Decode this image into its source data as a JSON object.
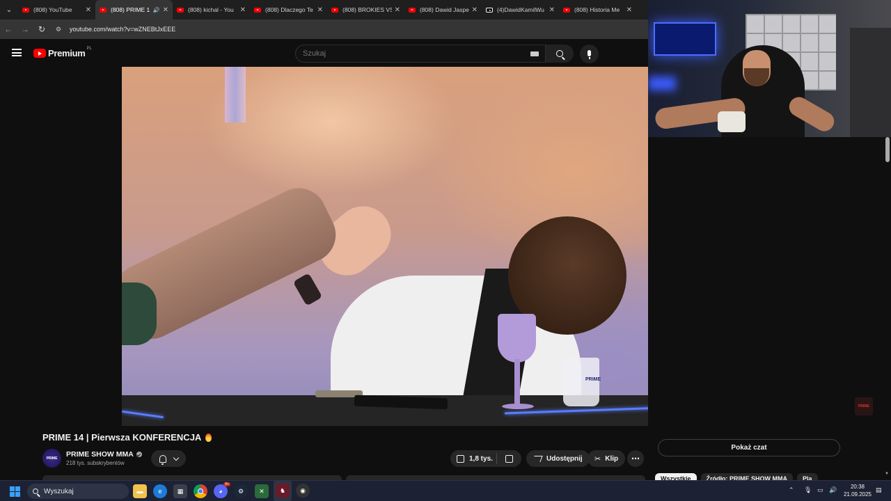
{
  "browser": {
    "tabs": [
      {
        "title": "(808) YouTube",
        "active": false,
        "icon": "youtube-icon"
      },
      {
        "title": "(808) PRIME 1",
        "active": true,
        "icon": "youtube-icon",
        "audio": true
      },
      {
        "title": "(808) kichal - You",
        "active": false,
        "icon": "youtube-icon"
      },
      {
        "title": "(808) Dlaczego Te",
        "active": false,
        "icon": "youtube-icon"
      },
      {
        "title": "(808) BROKIES VS",
        "active": false,
        "icon": "youtube-icon"
      },
      {
        "title": "(808) Dawid Jaspe",
        "active": false,
        "icon": "youtube-icon"
      },
      {
        "title": "(4)DawidKamilWu",
        "active": false,
        "icon": "tiktok-icon"
      },
      {
        "title": "(808) Historia Me",
        "active": false,
        "icon": "youtube-icon"
      }
    ],
    "url": "youtube.com/watch?v=wZNEBtJxEEE"
  },
  "youtube": {
    "logo_word": "Premium",
    "logo_region": "PL",
    "search_placeholder": "Szukaj"
  },
  "video": {
    "title": "PRIME 14 | Pierwsza KONFERENCJA",
    "cup_label": "PRIME",
    "watermark": "PRIME"
  },
  "channel": {
    "avatar_text": "PRIME",
    "name": "PRIME SHOW MMA",
    "subscribers": "218 tys. subskrybentów"
  },
  "actions": {
    "likes": "1,8 tys.",
    "share": "Udostępnij",
    "clip": "Klip",
    "more": "⋯"
  },
  "sidebar": {
    "show_chat": "Pokaż czat",
    "chips": [
      "Wszystkie",
      "Źródło: PRIME SHOW MMA",
      "Pla"
    ]
  },
  "taskbar": {
    "search": "Wyszukaj",
    "time": "20:38",
    "date": "21.09.2025",
    "discord_badge": "9+"
  }
}
